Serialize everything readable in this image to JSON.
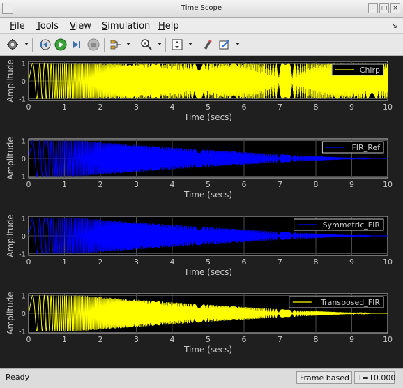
{
  "window": {
    "title": "Time Scope"
  },
  "menu": {
    "items": [
      {
        "label": "File",
        "mnemonic": "F",
        "rest": "ile"
      },
      {
        "label": "Tools",
        "mnemonic": "T",
        "rest": "ools"
      },
      {
        "label": "View",
        "mnemonic": "V",
        "rest": "iew"
      },
      {
        "label": "Simulation",
        "mnemonic": "S",
        "rest": "imulation"
      },
      {
        "label": "Help",
        "mnemonic": "H",
        "rest": "elp"
      }
    ]
  },
  "toolbar": {
    "icons": [
      "gear-icon",
      "step-back-icon",
      "run-icon",
      "step-forward-icon",
      "stop-icon",
      "signal-select-icon",
      "zoom-in-icon",
      "autoscale-icon",
      "style-icon",
      "measure-icon"
    ]
  },
  "colors": {
    "background": "#1f1f1f",
    "yellow": "#ffff00",
    "blue": "#0000ff",
    "axis": "#c8c8c8",
    "grid": "#4a4a4a"
  },
  "chart_data": [
    {
      "type": "line",
      "series": [
        {
          "name": "Chirp",
          "color": "#ffff00"
        }
      ],
      "signal": "chirp",
      "xlabel": "Time (secs)",
      "ylabel": "Amplitude",
      "xlim": [
        0,
        10
      ],
      "ylim": [
        -1.1,
        1.1
      ],
      "xticks": [
        0,
        1,
        2,
        3,
        4,
        5,
        6,
        7,
        8,
        9,
        10
      ],
      "yticks": [
        -1,
        0,
        1
      ],
      "grid": true,
      "legend": "top-right"
    },
    {
      "type": "line",
      "series": [
        {
          "name": "FIR_Ref",
          "color": "#0000ff"
        }
      ],
      "signal": "lowpass-chirp",
      "xlabel": "Time (secs)",
      "ylabel": "Amplitude",
      "xlim": [
        0,
        10
      ],
      "ylim": [
        -1.1,
        1.1
      ],
      "xticks": [
        0,
        1,
        2,
        3,
        4,
        5,
        6,
        7,
        8,
        9,
        10
      ],
      "yticks": [
        -1,
        0,
        1
      ],
      "grid": true,
      "legend": "top-right"
    },
    {
      "type": "line",
      "series": [
        {
          "name": "Symmetric_FIR",
          "color": "#0000ff"
        }
      ],
      "signal": "lowpass-chirp",
      "xlabel": "Time (secs)",
      "ylabel": "Amplitude",
      "xlim": [
        0,
        10
      ],
      "ylim": [
        -1.1,
        1.1
      ],
      "xticks": [
        0,
        1,
        2,
        3,
        4,
        5,
        6,
        7,
        8,
        9,
        10
      ],
      "yticks": [
        -1,
        0,
        1
      ],
      "grid": true,
      "legend": "top-right"
    },
    {
      "type": "line",
      "series": [
        {
          "name": "Transposed_FIR",
          "color": "#ffff00"
        }
      ],
      "signal": "lowpass-chirp",
      "xlabel": "Time (secs)",
      "ylabel": "Amplitude",
      "xlim": [
        0,
        10
      ],
      "ylim": [
        -1.1,
        1.1
      ],
      "xticks": [
        0,
        1,
        2,
        3,
        4,
        5,
        6,
        7,
        8,
        9,
        10
      ],
      "yticks": [
        -1,
        0,
        1
      ],
      "grid": true,
      "legend": "top-right"
    }
  ],
  "status": {
    "text": "Ready",
    "mode": "Frame based",
    "time": "T=10.000"
  }
}
